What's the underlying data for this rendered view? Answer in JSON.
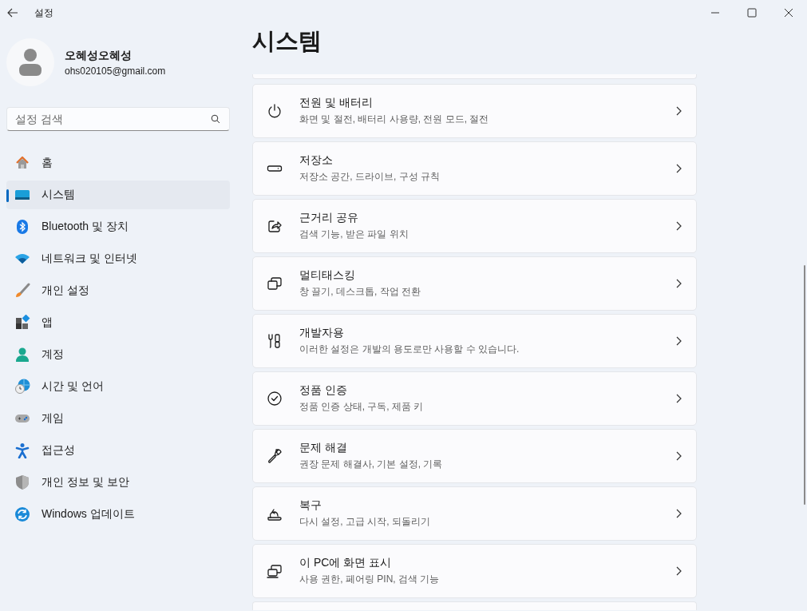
{
  "window": {
    "title": "설정"
  },
  "profile": {
    "name": "오혜성오혜성",
    "email": "ohs020105@gmail.com"
  },
  "search": {
    "placeholder": "설정 검색"
  },
  "sidebar": {
    "items": [
      {
        "label": "홈",
        "selected": false
      },
      {
        "label": "시스템",
        "selected": true
      },
      {
        "label": "Bluetooth 및 장치",
        "selected": false
      },
      {
        "label": "네트워크 및 인터넷",
        "selected": false
      },
      {
        "label": "개인 설정",
        "selected": false
      },
      {
        "label": "앱",
        "selected": false
      },
      {
        "label": "계정",
        "selected": false
      },
      {
        "label": "시간 및 언어",
        "selected": false
      },
      {
        "label": "게임",
        "selected": false
      },
      {
        "label": "접근성",
        "selected": false
      },
      {
        "label": "개인 정보 및 보안",
        "selected": false
      },
      {
        "label": "Windows 업데이트",
        "selected": false
      }
    ]
  },
  "page": {
    "title": "시스템",
    "cards": [
      {
        "title": "전원 및 배터리",
        "subtitle": "화면 및 절전, 배터리 사용량, 전원 모드, 절전"
      },
      {
        "title": "저장소",
        "subtitle": "저장소 공간, 드라이브, 구성 규칙"
      },
      {
        "title": "근거리 공유",
        "subtitle": "검색 기능, 받은 파일 위치"
      },
      {
        "title": "멀티태스킹",
        "subtitle": "창 끌기, 데스크톱, 작업 전환"
      },
      {
        "title": "개발자용",
        "subtitle": "이러한 설정은 개발의 용도로만 사용할 수 있습니다."
      },
      {
        "title": "정품 인증",
        "subtitle": "정품 인증 상태, 구독, 제품 키"
      },
      {
        "title": "문제 해결",
        "subtitle": "권장 문제 해결사, 기본 설정, 기록"
      },
      {
        "title": "복구",
        "subtitle": "다시 설정, 고급 시작, 되돌리기"
      },
      {
        "title": "이 PC에 화면 표시",
        "subtitle": "사용 권한, 페어링 PIN, 검색 기능"
      }
    ]
  }
}
